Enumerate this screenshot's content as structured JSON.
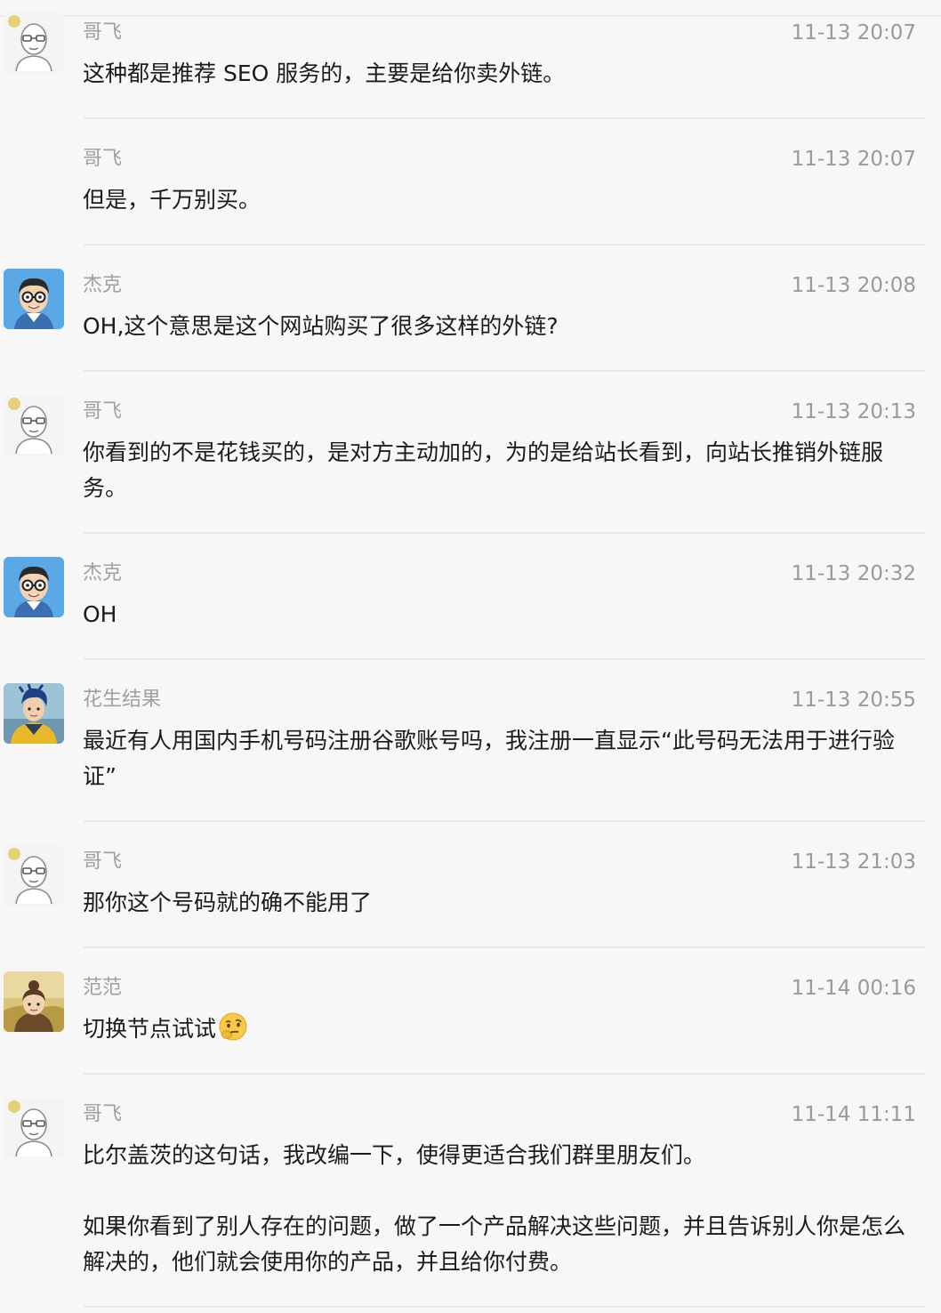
{
  "messages": [
    {
      "sender": "哥飞",
      "time": "11-13 20:07",
      "avatar": "gefei-avatar",
      "lines": [
        "这种都是推荐 SEO 服务的，主要是给你卖外链。"
      ]
    },
    {
      "sender": "哥飞",
      "time": "11-13 20:07",
      "avatar": "",
      "lines": [
        "但是，千万别买。"
      ]
    },
    {
      "sender": "杰克",
      "time": "11-13 20:08",
      "avatar": "jack-avatar",
      "lines": [
        "OH,这个意思是这个网站购买了很多这样的外链?"
      ]
    },
    {
      "sender": "哥飞",
      "time": "11-13 20:13",
      "avatar": "gefei-avatar",
      "lines": [
        "你看到的不是花钱买的，是对方主动加的，为的是给站长看到，向站长推销外链服务。"
      ]
    },
    {
      "sender": "杰克",
      "time": "11-13 20:32",
      "avatar": "jack-avatar",
      "lines": [
        "OH"
      ]
    },
    {
      "sender": "花生结果",
      "time": "11-13 20:55",
      "avatar": "huasheng-avatar",
      "lines": [
        "最近有人用国内手机号码注册谷歌账号吗，我注册一直显示“此号码无法用于进行验证”"
      ]
    },
    {
      "sender": "哥飞",
      "time": "11-13 21:03",
      "avatar": "gefei-avatar",
      "lines": [
        "那你这个号码就的确不能用了"
      ]
    },
    {
      "sender": "范范",
      "time": "11-14 00:16",
      "avatar": "fanfan-avatar",
      "lines": [
        "切换节点试试"
      ],
      "emoji": "thinking-face-emoji"
    },
    {
      "sender": "哥飞",
      "time": "11-14 11:11",
      "avatar": "gefei-avatar",
      "lines": [
        "比尔盖茨的这句话，我改编一下，使得更适合我们群里朋友们。",
        "如果你看到了别人存在的问题，做了一个产品解决这些问题，并且告诉别人你是怎么解决的，他们就会使用你的产品，并且给你付费。"
      ]
    }
  ],
  "colors": {
    "background": "#f7f7f7",
    "sender": "#a0a0a0",
    "time": "#9a9a9a",
    "text": "#1b1b1b",
    "divider": "#e9e9e9"
  }
}
